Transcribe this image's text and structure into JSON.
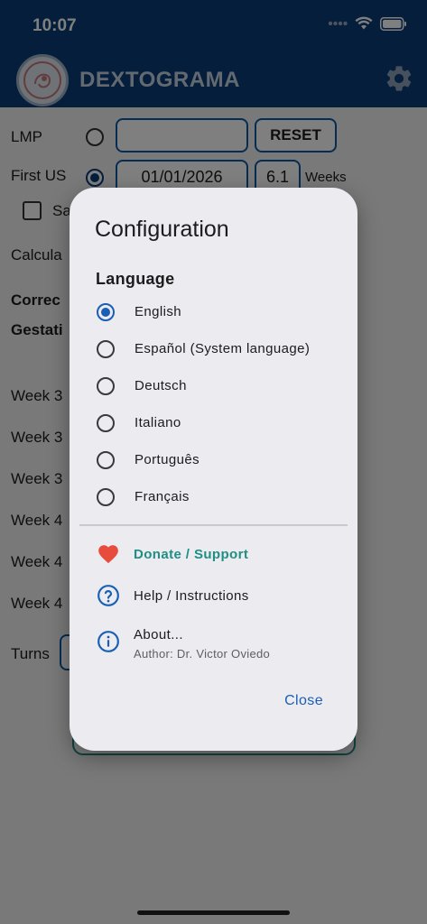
{
  "status_bar": {
    "time": "10:07"
  },
  "app_bar": {
    "title": "DEXTOGRAMA"
  },
  "background": {
    "lmp_label": "LMP",
    "reset_label": "RESET",
    "first_us_label": "First US",
    "first_us_date": "01/01/2026",
    "first_us_weeks_value": "6.1",
    "weeks_label": "Weeks",
    "checkbox_label_partial": "Sa",
    "calc_label_partial": "Calcula",
    "corrected_partial": "Correc",
    "gestation_partial": "Gestati",
    "week_rows": [
      "Week 3",
      "Week 3",
      "Week 3",
      "Week 4",
      "Week 4",
      "Week 4"
    ],
    "turns_label": "Turns"
  },
  "dialog": {
    "title": "Configuration",
    "language_section": "Language",
    "languages": [
      {
        "label": "English",
        "selected": true
      },
      {
        "label": "Español (System language)",
        "selected": false
      },
      {
        "label": "Deutsch",
        "selected": false
      },
      {
        "label": "Italiano",
        "selected": false
      },
      {
        "label": "Português",
        "selected": false
      },
      {
        "label": "Français",
        "selected": false
      }
    ],
    "donate_label": "Donate / Support",
    "help_label": "Help / Instructions",
    "about_label": "About...",
    "about_author": "Author: Dr. Victor Oviedo",
    "close_label": "Close"
  },
  "colors": {
    "primary": "#0b3d78",
    "accent_blue": "#1a5fb4",
    "donate_teal": "#1f8f84",
    "heart_red": "#e74c3c"
  }
}
